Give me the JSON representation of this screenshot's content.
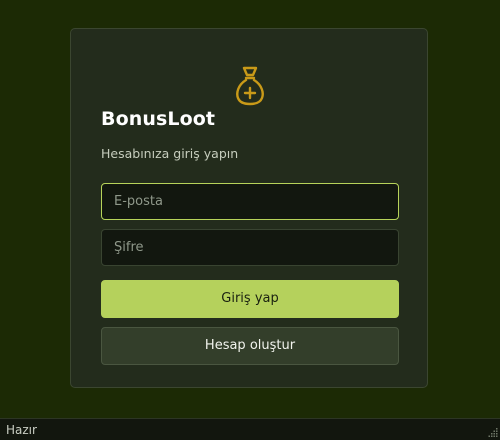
{
  "login": {
    "logo_icon": "money-bag-plus-icon",
    "brand": "BonusLoot",
    "subtitle": "Hesabınıza giriş yapın",
    "email": {
      "placeholder": "E-posta",
      "value": ""
    },
    "password": {
      "placeholder": "Şifre",
      "value": ""
    },
    "login_button": "Giriş yap",
    "register_button": "Hesap oluştur"
  },
  "statusbar": {
    "text": "Hazır",
    "grip_icon": "resize-grip-icon"
  },
  "colors": {
    "background": "#1c2a05",
    "card": "#232c1c",
    "accent": "#b5d15c",
    "logo": "#c99a18"
  }
}
